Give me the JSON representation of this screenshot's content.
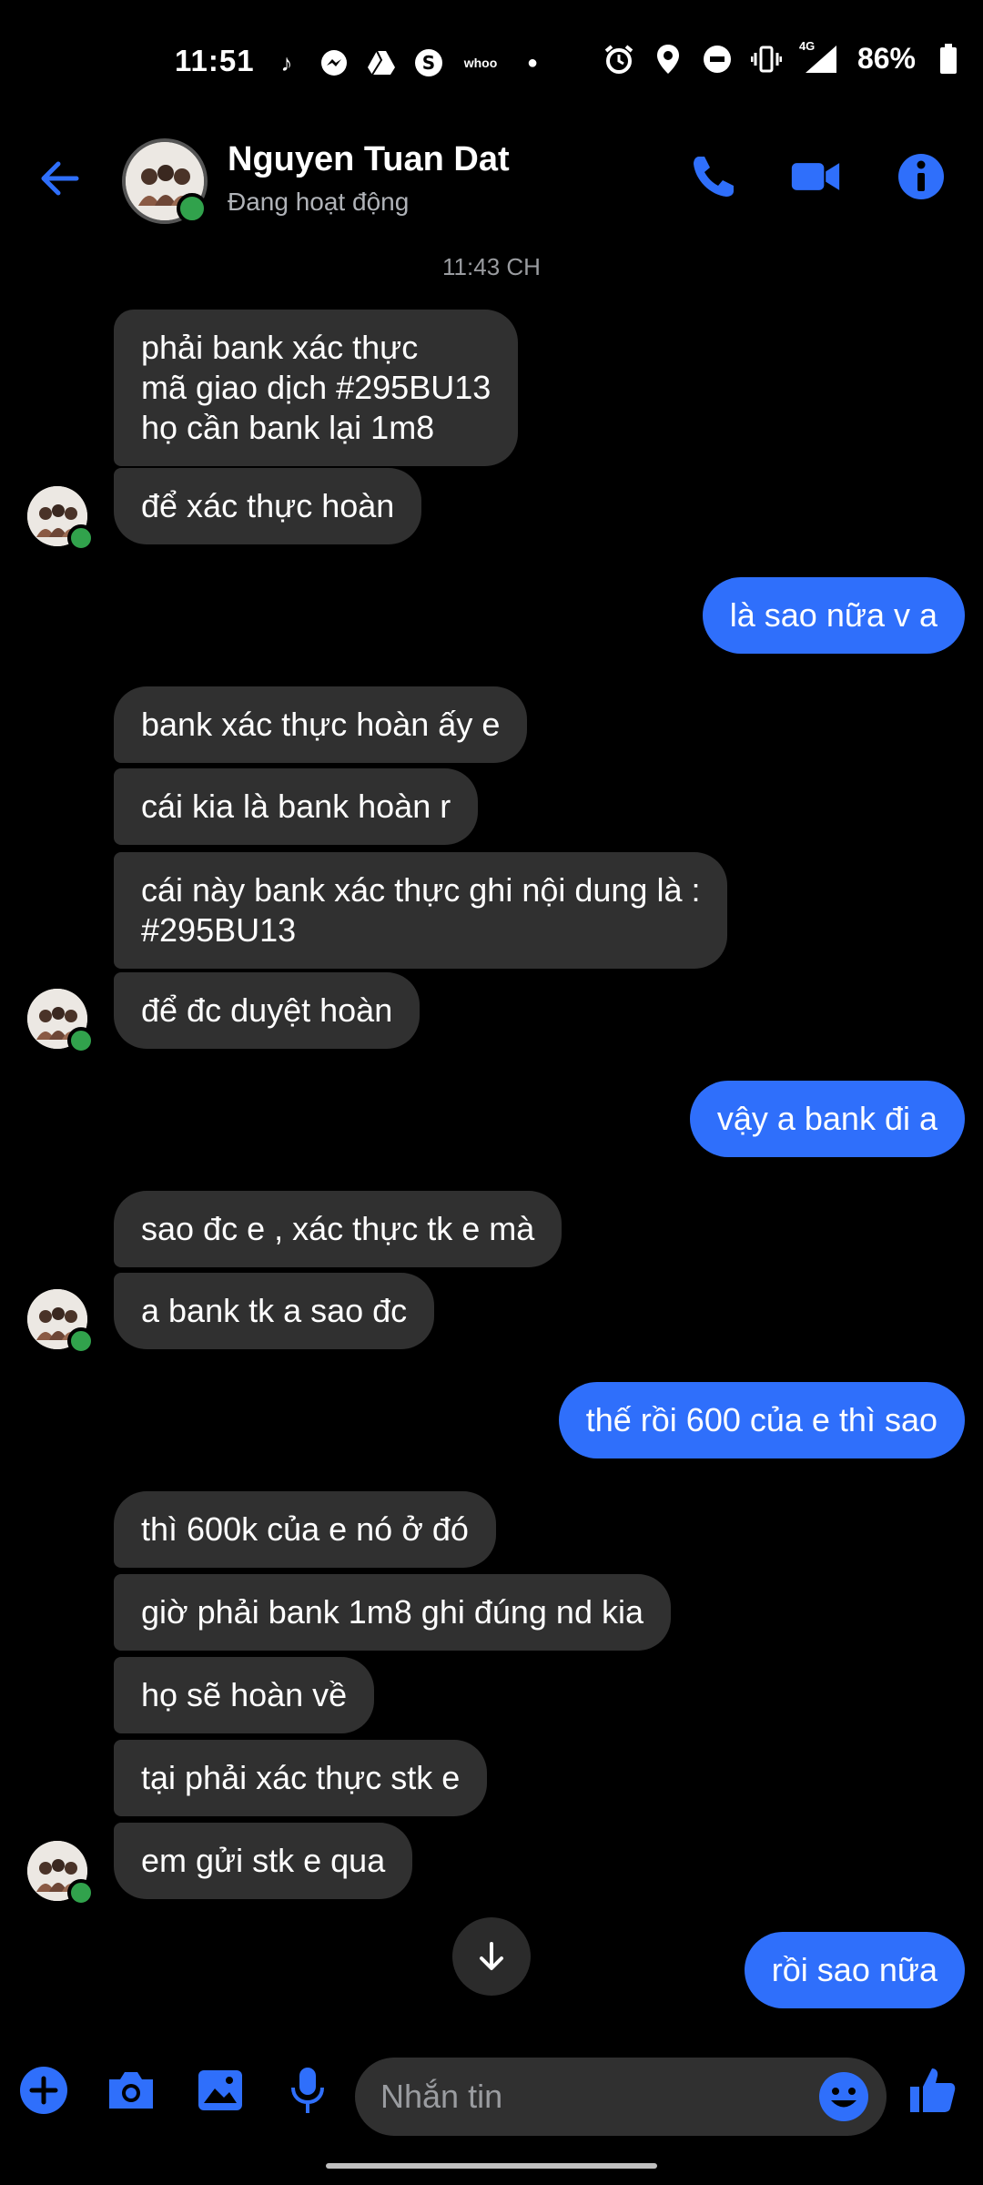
{
  "status_bar": {
    "time": "11:51",
    "app_icons": [
      "tiktok-icon",
      "messenger-icon",
      "drive-icon",
      "shazam-icon",
      "whoo-icon"
    ],
    "whoo_label": "whoo",
    "network": "4G",
    "battery": "86%"
  },
  "header": {
    "name": "Nguyen Tuan Dat",
    "presence": "Đang hoạt động"
  },
  "messages": {
    "timestamp": "11:43 CH",
    "m1": "phải bank xác thực\nmã giao dịch #295BU13\nhọ cần bank lại 1m8",
    "m2": "để xác thực hoàn",
    "m3": "là sao nữa v a",
    "m4": "bank xác thực hoàn ấy e",
    "m5": "cái kia là bank hoàn r",
    "m6": "cái này bank xác thực ghi nội dung là :\n#295BU13",
    "m7": "để đc duyệt hoàn",
    "m8": "vậy a bank đi a",
    "m9": "sao  đc e , xác thực tk e mà",
    "m10": "a bank tk a sao đc",
    "m11": "thế rồi 600 của e thì sao",
    "m12": "thì 600k của e nó ở đó",
    "m13": "giờ phải bank 1m8 ghi đúng nd kia",
    "m14": "họ sẽ hoàn về",
    "m15": "tại phải xác thực stk e",
    "m16": "em gửi stk e qua",
    "m17": "rồi sao nữa"
  },
  "composer": {
    "placeholder": "Nhắn tin"
  },
  "colors": {
    "accent": "#2f6ffb",
    "incoming_bubble": "#303030",
    "online": "#31a24c"
  }
}
